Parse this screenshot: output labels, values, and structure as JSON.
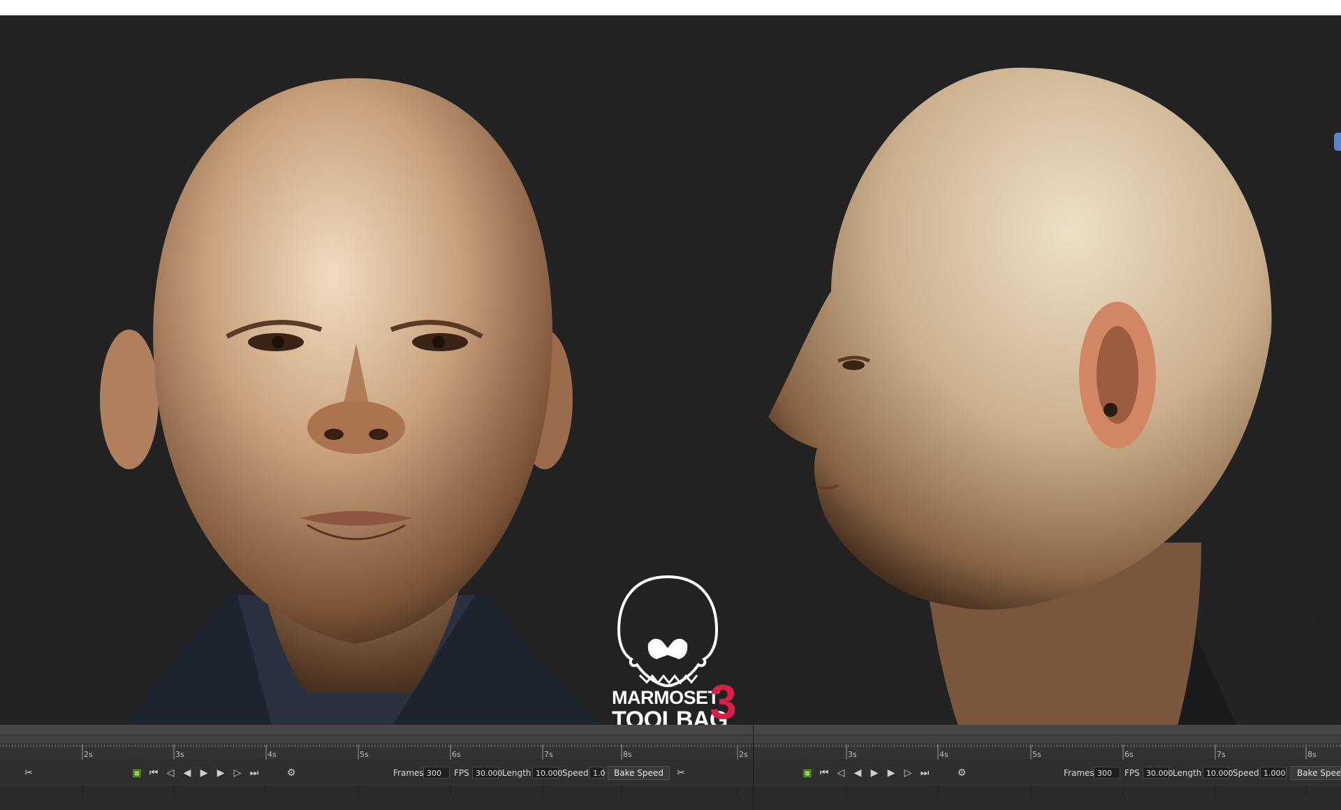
{
  "branding": {
    "line1": "MARMOSET",
    "line2": "TOOLBAG",
    "version": "3",
    "accent": "#d91e48"
  },
  "ruler_left": [
    "2s",
    "3s",
    "4s",
    "5s",
    "6s",
    "7s",
    "8s"
  ],
  "ruler_right": [
    "2s",
    "3s",
    "4s",
    "5s",
    "6s",
    "7s",
    "8s"
  ],
  "panel_left": {
    "frames_label": "Frames",
    "frames_value": "300",
    "fps_label": "FPS",
    "fps_value": "30.000",
    "length_label": "Length",
    "length_value": "10.000",
    "speed_label": "Speed",
    "speed_value": "1.0",
    "bake_label": "Bake Speed"
  },
  "panel_right": {
    "frames_label": "Frames",
    "frames_value": "300",
    "fps_label": "FPS",
    "fps_value": "30.000",
    "length_label": "Length",
    "length_value": "10.000",
    "speed_label": "Speed",
    "speed_value": "1.000",
    "bake_label": "Bake Speed"
  },
  "icons": [
    "keyframe-tool-icon",
    "loop-icon",
    "skip-start-icon",
    "prev-key-icon",
    "step-back-icon",
    "play-icon",
    "step-forward-icon",
    "next-key-icon",
    "skip-end-icon",
    "settings-icon"
  ]
}
